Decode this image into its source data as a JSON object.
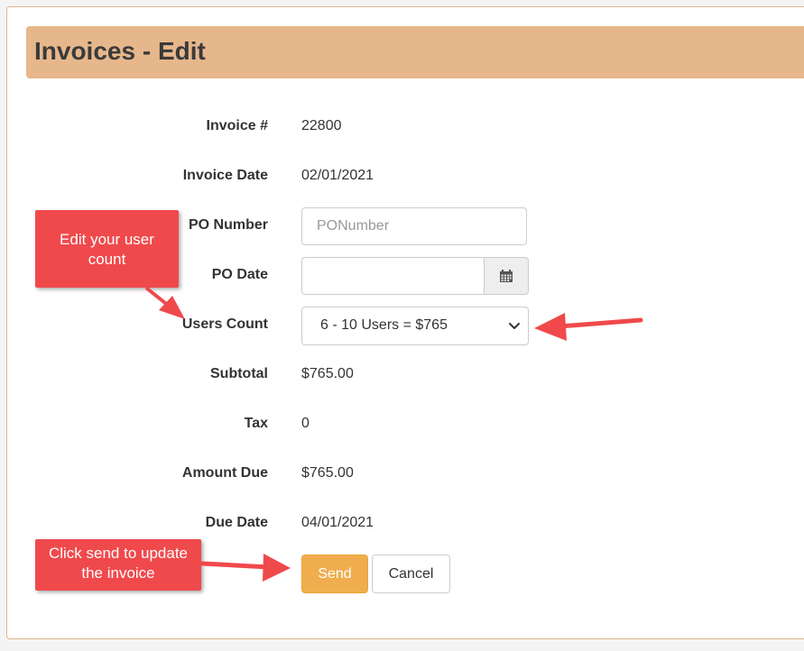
{
  "page": {
    "title": "Invoices - Edit"
  },
  "form": {
    "invoice_no": {
      "label": "Invoice #",
      "value": "22800"
    },
    "invoice_date": {
      "label": "Invoice Date",
      "value": "02/01/2021"
    },
    "po_number": {
      "label": "PO Number",
      "placeholder": "PONumber",
      "value": ""
    },
    "po_date": {
      "label": "PO Date",
      "value": ""
    },
    "users_count": {
      "label": "Users Count",
      "selected": "6 - 10 Users = $765"
    },
    "subtotal": {
      "label": "Subtotal",
      "value": "$765.00"
    },
    "tax": {
      "label": "Tax",
      "value": "0"
    },
    "amount_due": {
      "label": "Amount Due",
      "value": "$765.00"
    },
    "due_date": {
      "label": "Due Date",
      "value": "04/01/2021"
    }
  },
  "buttons": {
    "send": "Send",
    "cancel": "Cancel"
  },
  "annotations": {
    "user_count_callout": {
      "line1": "Edit your user",
      "line2": "count"
    },
    "send_callout": {
      "line1": "Click send to update",
      "line2": "the invoice"
    }
  },
  "colors": {
    "header_bg": "#e7b78c",
    "send_button": "#f0ad4e",
    "callout": "#f0494c"
  },
  "icons": {
    "calendar": "calendar-icon",
    "select_chevron": "chevron-down-icon"
  }
}
